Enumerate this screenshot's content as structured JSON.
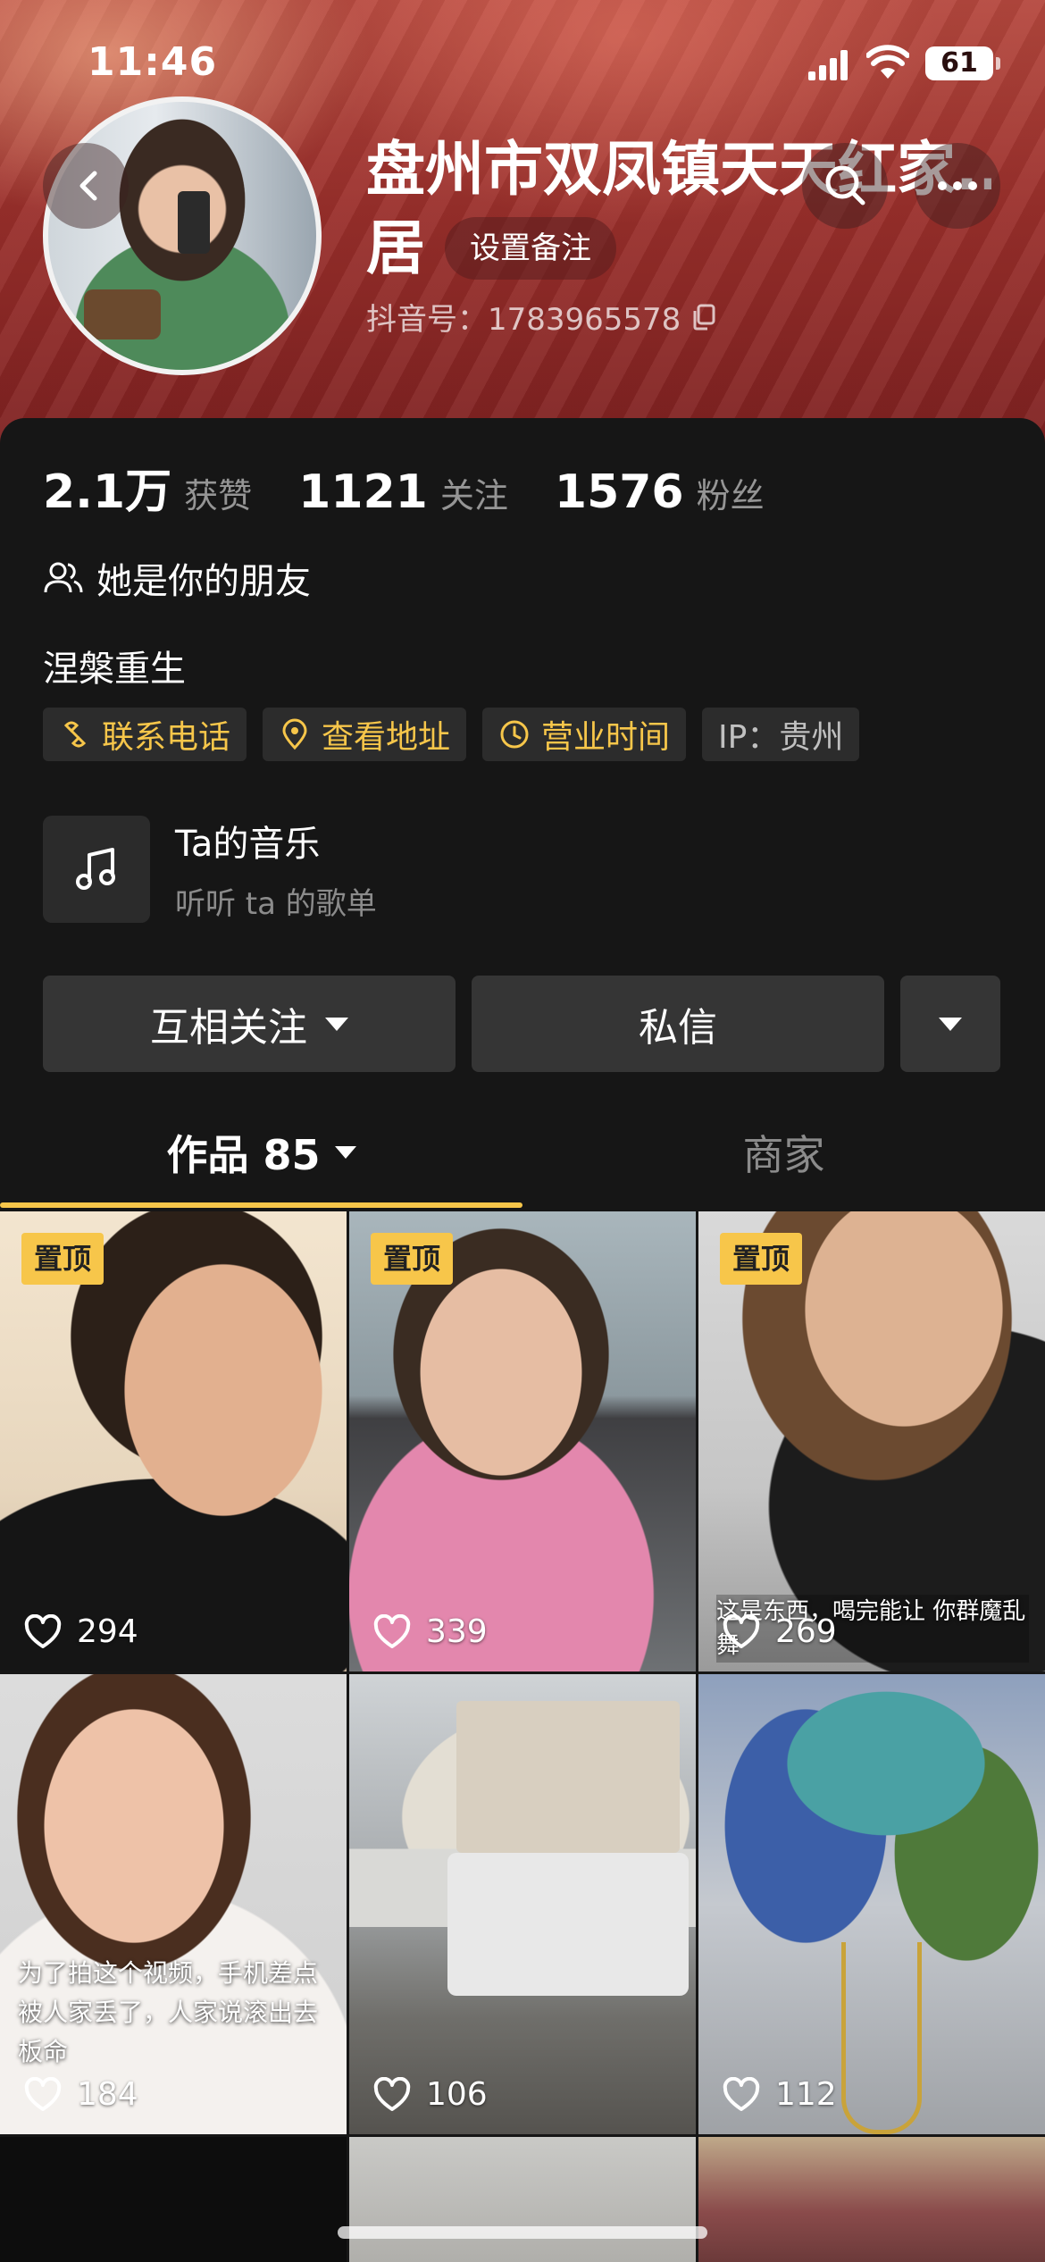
{
  "status_bar": {
    "time": "11:46",
    "battery": "61"
  },
  "profile": {
    "name": "盘州市双凤镇天天红家..",
    "name_line2": "居",
    "set_note_label": "设置备注",
    "douyin_id": "抖音号：1783965578"
  },
  "stats": [
    {
      "value": "2.1万",
      "label": "获赞"
    },
    {
      "value": "1121",
      "label": "关注"
    },
    {
      "value": "1576",
      "label": "粉丝"
    }
  ],
  "friend_text": "她是你的朋友",
  "bio": "涅槃重生",
  "tags": [
    {
      "label": "联系电话",
      "icon": "link-icon"
    },
    {
      "label": "查看地址",
      "icon": "location-pin-icon"
    },
    {
      "label": "营业时间",
      "icon": "clock-icon"
    },
    {
      "label": "IP：贵州",
      "icon": ""
    }
  ],
  "music": {
    "title": "Ta的音乐",
    "subtitle": "听听 ta 的歌单"
  },
  "actions": {
    "follow_label": "互相关注",
    "message_label": "私信"
  },
  "tabs": [
    {
      "label": "作品 85",
      "active": true
    },
    {
      "label": "商家",
      "active": false
    }
  ],
  "videos": [
    {
      "pinned": true,
      "pin_label": "置顶",
      "likes": "294"
    },
    {
      "pinned": true,
      "pin_label": "置顶",
      "likes": "339"
    },
    {
      "pinned": true,
      "pin_label": "置顶",
      "likes": "269",
      "caption": "这是东西，喝完能让 你群魔乱舞"
    },
    {
      "pinned": false,
      "likes": "184",
      "caption": "为了拍这个视频，手机差点 被人家丢了，人家说滚出去 板命"
    },
    {
      "pinned": false,
      "likes": "106"
    },
    {
      "pinned": false,
      "likes": "112"
    }
  ],
  "colors": {
    "accent": "#f7c64a",
    "panel_bg": "#161616",
    "button_bg": "#353535"
  }
}
